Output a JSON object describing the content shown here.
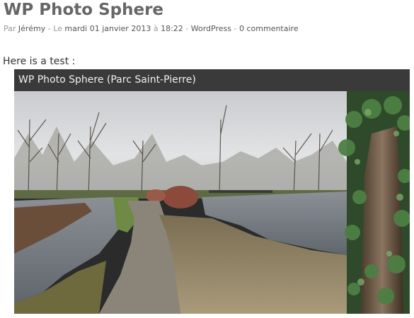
{
  "post": {
    "title": "WP Photo Sphere",
    "meta": {
      "by_label": "Par",
      "author": "Jérémy",
      "sep1": "-",
      "on_label": "Le",
      "date": "mardi 01 janvier 2013",
      "at_label": "à",
      "time": "18:22",
      "sep2": "-",
      "category": "WordPress",
      "sep3": "-",
      "comments": "0 commentaire"
    },
    "body_text": "Here is a test :"
  },
  "photo_sphere": {
    "title": "WP Photo Sphere (Parc Saint-Pierre)"
  },
  "colors": {
    "title": "#666666",
    "meta": "#999999",
    "viewer_bar": "#3a3a3a",
    "sky": "#d9dadc",
    "water": "#6f7479",
    "ivy": "#3f6b3a"
  }
}
